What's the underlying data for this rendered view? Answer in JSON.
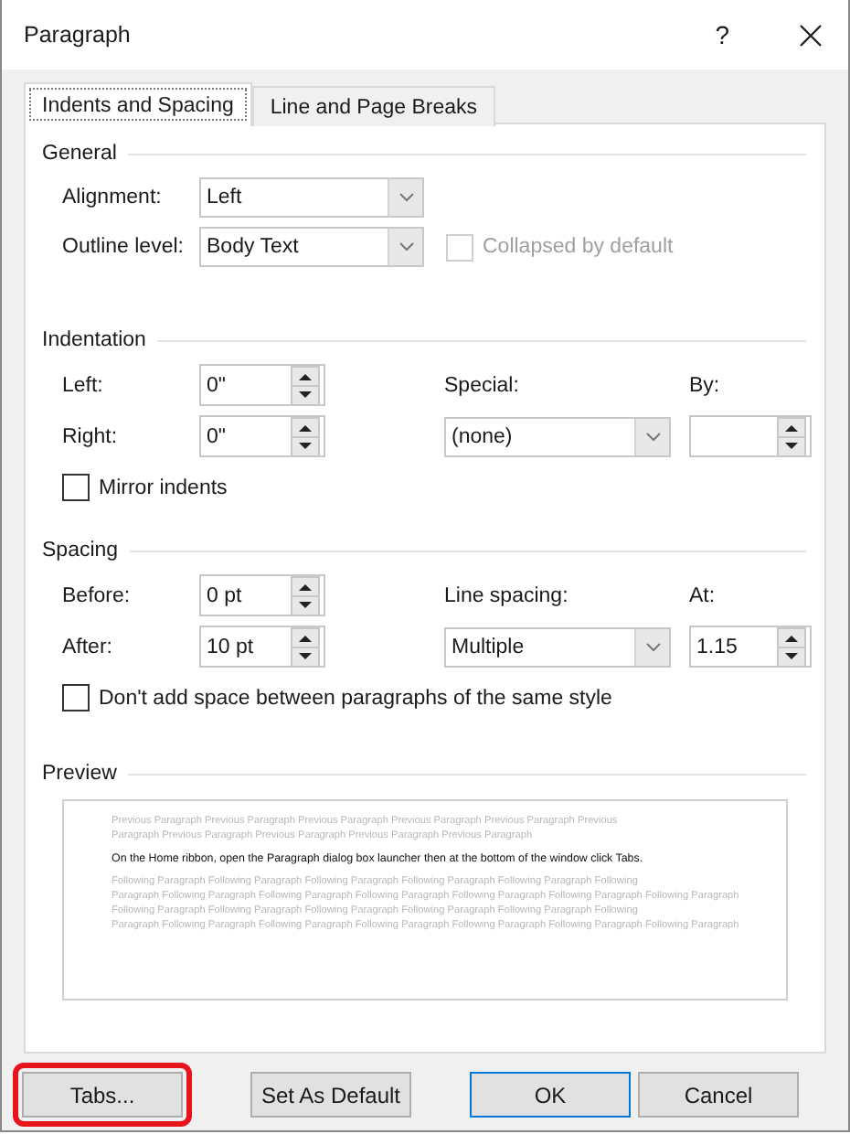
{
  "window": {
    "title": "Paragraph",
    "help": "?"
  },
  "tabs": [
    {
      "label": "Indents and Spacing",
      "selected": true
    },
    {
      "label": "Line and Page Breaks",
      "selected": false
    }
  ],
  "general": {
    "heading": "General",
    "alignment": {
      "label": "Alignment:",
      "value": "Left"
    },
    "outline_level": {
      "label": "Outline level:",
      "value": "Body Text"
    },
    "collapsed": {
      "label": "Collapsed by default",
      "checked": false,
      "disabled": true
    }
  },
  "indentation": {
    "heading": "Indentation",
    "left": {
      "label": "Left:",
      "value": "0\""
    },
    "right": {
      "label": "Right:",
      "value": "0\""
    },
    "special": {
      "label": "Special:",
      "value": "(none)"
    },
    "by": {
      "label": "By:"
    },
    "mirror": {
      "label": "Mirror indents",
      "checked": false
    }
  },
  "spacing": {
    "heading": "Spacing",
    "before": {
      "label": "Before:",
      "value": "0 pt"
    },
    "after": {
      "label": "After:",
      "value": "10 pt"
    },
    "line_spacing": {
      "label": "Line spacing:",
      "value": "Multiple"
    },
    "at": {
      "label": "At:",
      "value": "1.15"
    },
    "dont_add": {
      "label": "Don't add space between paragraphs of the same style",
      "checked": false
    }
  },
  "preview": {
    "heading": "Preview",
    "previous": [
      "Previous Paragraph Previous Paragraph Previous Paragraph Previous Paragraph Previous Paragraph Previous",
      "Paragraph Previous Paragraph Previous Paragraph Previous Paragraph Previous Paragraph"
    ],
    "current": "On the Home ribbon, open the Paragraph dialog box launcher then at the bottom of the window click Tabs.",
    "following": [
      "Following Paragraph Following Paragraph Following Paragraph Following Paragraph Following Paragraph Following",
      "Paragraph Following Paragraph Following Paragraph Following Paragraph Following Paragraph Following Paragraph Following Paragraph",
      "Following Paragraph Following Paragraph Following Paragraph Following Paragraph Following Paragraph Following",
      "Paragraph Following Paragraph Following Paragraph Following Paragraph Following Paragraph Following Paragraph Following Paragraph"
    ]
  },
  "buttons": [
    {
      "label": "Tabs...",
      "highlighted": true,
      "default": false
    },
    {
      "label": "Set As Default",
      "highlighted": false,
      "default": false
    },
    {
      "label": "OK",
      "highlighted": false,
      "default": true
    },
    {
      "label": "Cancel",
      "highlighted": false,
      "default": false
    }
  ]
}
